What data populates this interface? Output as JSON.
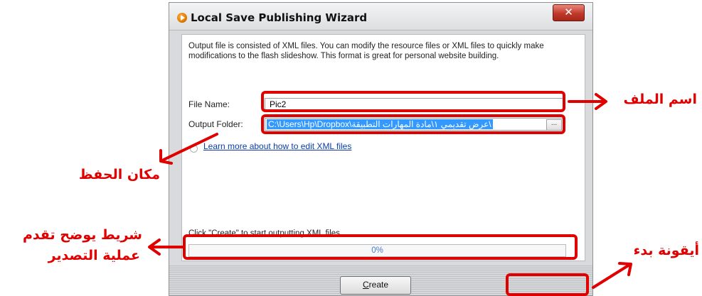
{
  "window": {
    "title": "Local Save Publishing Wizard",
    "close_label": "✕"
  },
  "description": "Output file is consisted of XML files. You can modify the resource files or XML files to quickly make modifications to the flash slideshow. This format is great for personal website building.",
  "file_name": {
    "label": "File Name:",
    "value": "Pic2"
  },
  "output_folder": {
    "label": "Output Folder:",
    "value": "C:\\Users\\Hp\\Dropbox\\عرض تقديمي ١\\مادة المهارات التطبيقة\\",
    "browse_label": "..."
  },
  "help_link": "Learn more about how to edit XML files",
  "status_text": "Click \"Create\" to start outputting XML files",
  "progress": {
    "value": 0,
    "label": "0%"
  },
  "create_button": {
    "mnemonic": "C",
    "rest": "reate"
  },
  "annotations": {
    "file_name": "اسم الملف",
    "save_location": "مكان الحفظ",
    "progress_bar_line1": "شريط يوضح تقدم",
    "progress_bar_line2": "عملية التصدير",
    "start_icon": "أيقونة بدء"
  },
  "colors": {
    "annotation": "#e00000",
    "selection": "#3399ff",
    "progress_text": "#4b79c9"
  }
}
